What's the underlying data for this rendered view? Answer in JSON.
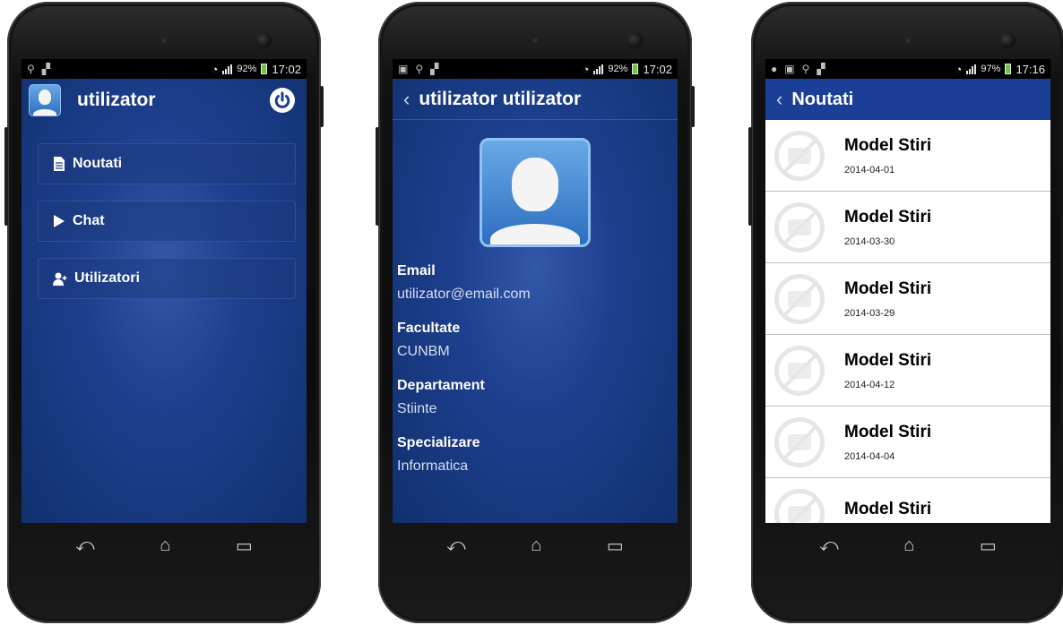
{
  "phone1": {
    "status": {
      "battery": "92%",
      "time": "17:02"
    },
    "header": {
      "title": "utilizator"
    },
    "menu": [
      {
        "label": "Noutati",
        "icon": "document-icon"
      },
      {
        "label": "Chat",
        "icon": "play-icon"
      },
      {
        "label": "Utilizatori",
        "icon": "add-user-icon"
      }
    ]
  },
  "phone2": {
    "status": {
      "battery": "92%",
      "time": "17:02"
    },
    "header": {
      "title": "utilizator utilizator",
      "back": "‹"
    },
    "fields": [
      {
        "label": "Email",
        "value": "utilizator@email.com"
      },
      {
        "label": "Facultate",
        "value": "CUNBM"
      },
      {
        "label": "Departament",
        "value": "Stiinte"
      },
      {
        "label": "Specializare",
        "value": "Informatica"
      }
    ]
  },
  "phone3": {
    "status": {
      "battery": "97%",
      "time": "17:16"
    },
    "header": {
      "title": "Noutati",
      "back": "‹"
    },
    "news": [
      {
        "title": "Model Stiri",
        "date": "2014-04-01"
      },
      {
        "title": "Model Stiri",
        "date": "2014-03-30"
      },
      {
        "title": "Model Stiri",
        "date": "2014-03-29"
      },
      {
        "title": "Model Stiri",
        "date": "2014-04-12"
      },
      {
        "title": "Model Stiri",
        "date": "2014-04-04"
      },
      {
        "title": "Model Stiri",
        "date": ""
      }
    ]
  },
  "colors": {
    "appbar": "#1b3f96",
    "accent_blue": "#11306f",
    "list_bg": "#ffffff"
  }
}
